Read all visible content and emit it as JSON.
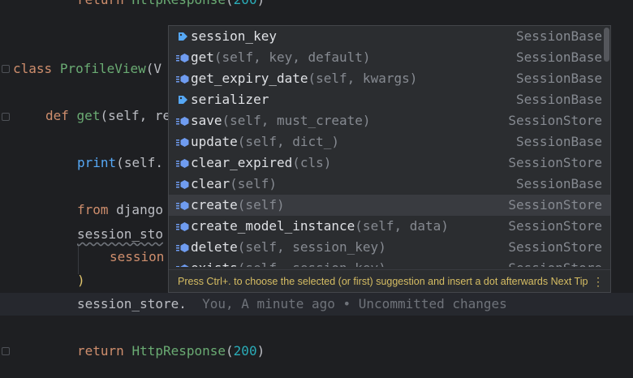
{
  "editor": {
    "lines": {
      "return_top": {
        "kw": "return",
        "call": "HttpResponse",
        "open": "(",
        "num": "200",
        "close": ")"
      },
      "class_decl": {
        "kw": "class",
        "name": "ProfileView",
        "rest": "(V"
      },
      "def_get": {
        "kw": "def",
        "name": "get",
        "open": "(",
        "self": "self",
        "rest": ", re"
      },
      "print_line": {
        "builtin": "print",
        "open": "(",
        "self": "self",
        "rest": "."
      },
      "from_line": {
        "kw": "from",
        "rest": " django"
      },
      "session_sto": {
        "text": "session_sto"
      },
      "session_inner": {
        "text": "session"
      },
      "paren_close": {
        "text": ")"
      },
      "current": {
        "text": "session_store.",
        "blame": "You, A minute ago • Uncommitted changes"
      },
      "return_bottom": {
        "kw": "return",
        "call": "HttpResponse",
        "open": "(",
        "num": "200",
        "close": ")"
      }
    }
  },
  "completion": {
    "items": [
      {
        "icon": "tag-icon",
        "name": "session_key",
        "args": "",
        "type": "SessionBase"
      },
      {
        "icon": "method-icon",
        "name": "get",
        "args": "(self, key, default)",
        "type": "SessionBase"
      },
      {
        "icon": "method-icon",
        "name": "get_expiry_date",
        "args": "(self, kwargs)",
        "type": "SessionBase"
      },
      {
        "icon": "tag-icon",
        "name": "serializer",
        "args": "",
        "type": "SessionBase"
      },
      {
        "icon": "method-icon",
        "name": "save",
        "args": "(self, must_create)",
        "type": "SessionStore"
      },
      {
        "icon": "method-icon",
        "name": "update",
        "args": "(self, dict_)",
        "type": "SessionBase"
      },
      {
        "icon": "method-icon",
        "name": "clear_expired",
        "args": "(cls)",
        "type": "SessionStore"
      },
      {
        "icon": "method-icon",
        "name": "clear",
        "args": "(self)",
        "type": "SessionBase"
      },
      {
        "icon": "method-icon",
        "name": "create",
        "args": "(self)",
        "type": "SessionStore"
      },
      {
        "icon": "method-icon",
        "name": "create_model_instance",
        "args": "(self, data)",
        "type": "SessionStore"
      },
      {
        "icon": "method-icon",
        "name": "delete",
        "args": "(self, session_key)",
        "type": "SessionStore"
      },
      {
        "icon": "method-icon",
        "name": "exists",
        "args": "(self, session_key)",
        "type": "SessionStore"
      }
    ],
    "selected_index": 8,
    "footer": "Press Ctrl+. to choose the selected (or first) suggestion and insert a dot afterwards  Next Tip",
    "more_icon": "vertical-dots-icon"
  },
  "colors": {
    "background": "#1e1f22",
    "popup": "#2b2d30",
    "selected": "#393b40",
    "tip": "#d6bd63"
  }
}
